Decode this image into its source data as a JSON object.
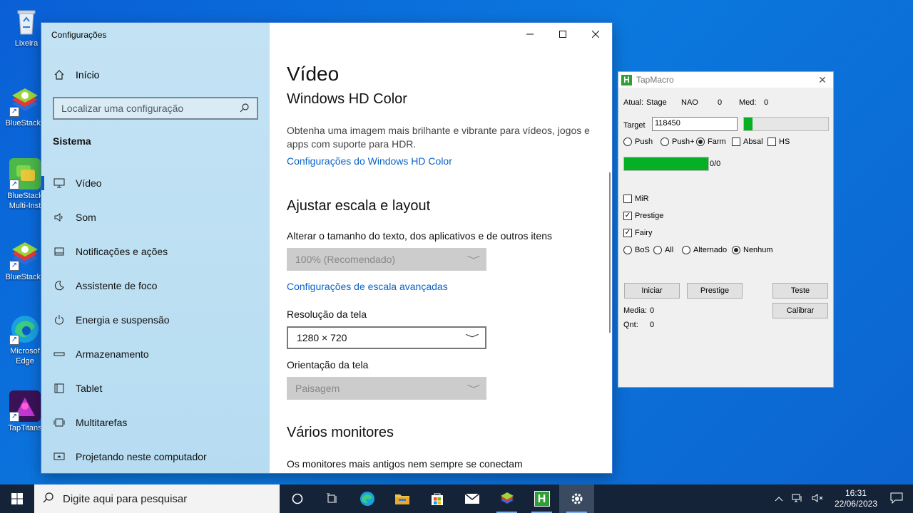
{
  "desktop_icons": [
    {
      "label": "Lixeira"
    },
    {
      "label": "BlueStacks"
    },
    {
      "label": "BlueStack Multi-Inst"
    },
    {
      "label": "BlueStacks"
    },
    {
      "label": "Microsof Edge"
    },
    {
      "label": "TapTitans"
    }
  ],
  "settings": {
    "window_title": "Configurações",
    "home_label": "Início",
    "search_placeholder": "Localizar uma configuração",
    "section_title": "Sistema",
    "nav": [
      {
        "label": "Vídeo",
        "icon": "monitor-icon"
      },
      {
        "label": "Som",
        "icon": "speaker-icon"
      },
      {
        "label": "Notificações e ações",
        "icon": "notification-icon"
      },
      {
        "label": "Assistente de foco",
        "icon": "moon-icon"
      },
      {
        "label": "Energia e suspensão",
        "icon": "power-icon"
      },
      {
        "label": "Armazenamento",
        "icon": "storage-icon"
      },
      {
        "label": "Tablet",
        "icon": "tablet-icon"
      },
      {
        "label": "Multitarefas",
        "icon": "multitask-icon"
      },
      {
        "label": "Projetando neste computador",
        "icon": "projector-icon"
      }
    ],
    "content": {
      "title": "Vídeo",
      "hdr_heading": "Windows HD Color",
      "hdr_desc": "Obtenha uma imagem mais brilhante e vibrante para vídeos, jogos e apps com suporte para HDR.",
      "hdr_link": "Configurações do Windows HD Color",
      "scale_heading": "Ajustar escala e layout",
      "scale_label": "Alterar o tamanho do texto, dos aplicativos e de outros itens",
      "scale_value": "100% (Recomendado)",
      "scale_link": "Configurações de escala avançadas",
      "resolution_label": "Resolução da tela",
      "resolution_value": "1280 × 720",
      "orientation_label": "Orientação da tela",
      "orientation_value": "Paisagem",
      "multi_heading": "Vários monitores",
      "multi_desc": "Os monitores mais antigos nem sempre se conectam"
    }
  },
  "tapmacro": {
    "title": "TapMacro",
    "atual_label": "Atual:",
    "stage_label": "Stage",
    "nao_label": "NAO",
    "nao_value": "0",
    "med_label": "Med:",
    "med_value": "0",
    "target_label": "Target",
    "target_value": "118450",
    "target_progress": 0.1,
    "mode_options": [
      "Push",
      "Push+",
      "Farm"
    ],
    "selected_mode": "Farm",
    "abisal_label": "Absal",
    "hs_label": "HS",
    "progress_text": "0/0",
    "progress_fill": 1.0,
    "mir_label": "MiR",
    "prestige_label": "Prestige",
    "fairy_label": "Fairy",
    "boss_options": [
      "BoS",
      "All",
      "Alternado",
      "Nenhum"
    ],
    "selected_boss": "Nenhum",
    "btn_start": "Iniciar",
    "btn_prestige": "Prestige",
    "btn_test": "Teste",
    "btn_calibrate": "Calibrar",
    "media_label": "Media:",
    "media_value": "0",
    "qnt_label": "Qnt:",
    "qnt_value": "0"
  },
  "taskbar": {
    "search_placeholder": "Digite aqui para pesquisar",
    "time": "16:31",
    "date": "22/06/2023"
  }
}
